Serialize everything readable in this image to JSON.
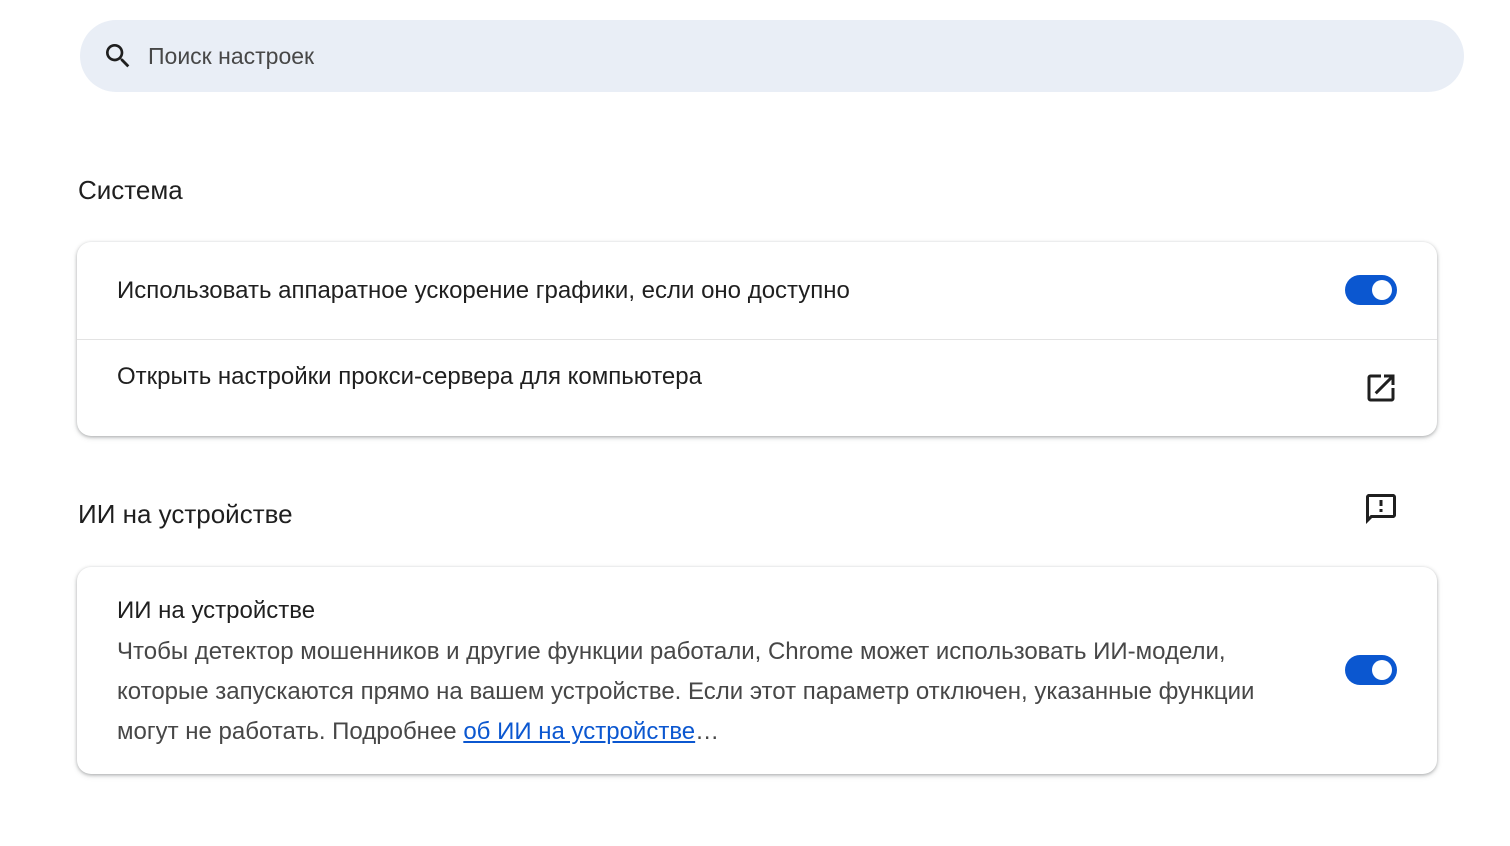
{
  "search": {
    "placeholder": "Поиск настроек",
    "icon": "search-icon"
  },
  "system": {
    "title": "Система",
    "hardware_acceleration": {
      "label": "Использовать аппаратное ускорение графики, если оно доступно",
      "enabled": true
    },
    "proxy": {
      "label": "Открыть настройки прокси-сервера для компьютера",
      "icon": "open-external-icon"
    }
  },
  "on_device_ai": {
    "title": "ИИ на устройстве",
    "feedback_icon": "feedback-icon",
    "setting": {
      "label": "ИИ на устройстве",
      "description": "Чтобы детектор мошенников и другие функции работали, Chrome может использовать ИИ-модели, которые запускаются прямо на вашем устройстве. Если этот параметр отключен, указанные функции могут не работать. Подробнее ",
      "link_text": "об ИИ на устройстве",
      "suffix": "…",
      "enabled": true
    }
  },
  "colors": {
    "accent": "#0b57d0",
    "search_bg": "#e9eef6"
  }
}
